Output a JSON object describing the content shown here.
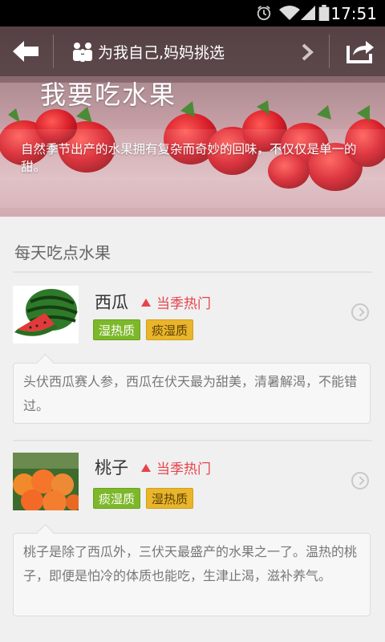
{
  "status_bar": {
    "time": "17:51"
  },
  "header": {
    "title": "为我自己,妈妈挑选",
    "hero_title": "我要吃水果",
    "hero_description": "自然季节出产的水果拥有复杂而奇妙的回味，不仅仅是单一的甜。"
  },
  "section": {
    "title": "每天吃点水果"
  },
  "fruits": [
    {
      "name": "西瓜",
      "hot_label": "当季热门",
      "tags": [
        "湿热质",
        "痰湿质"
      ],
      "description": "头伏西瓜赛人参，西瓜在伏天最为甜美，清暑解渴，不能错过。"
    },
    {
      "name": "桃子",
      "hot_label": "当季热门",
      "tags": [
        "痰湿质",
        "湿热质"
      ],
      "description": "桃子是除了西瓜外，三伏天最盛产的水果之一了。温热的桃子，即便是怕冷的体质也能吃，生津止渴，滋补养气。"
    }
  ],
  "colors": {
    "hot": "#e8434c",
    "tag_green": "#7db82a",
    "tag_orange": "#e8b52b"
  }
}
